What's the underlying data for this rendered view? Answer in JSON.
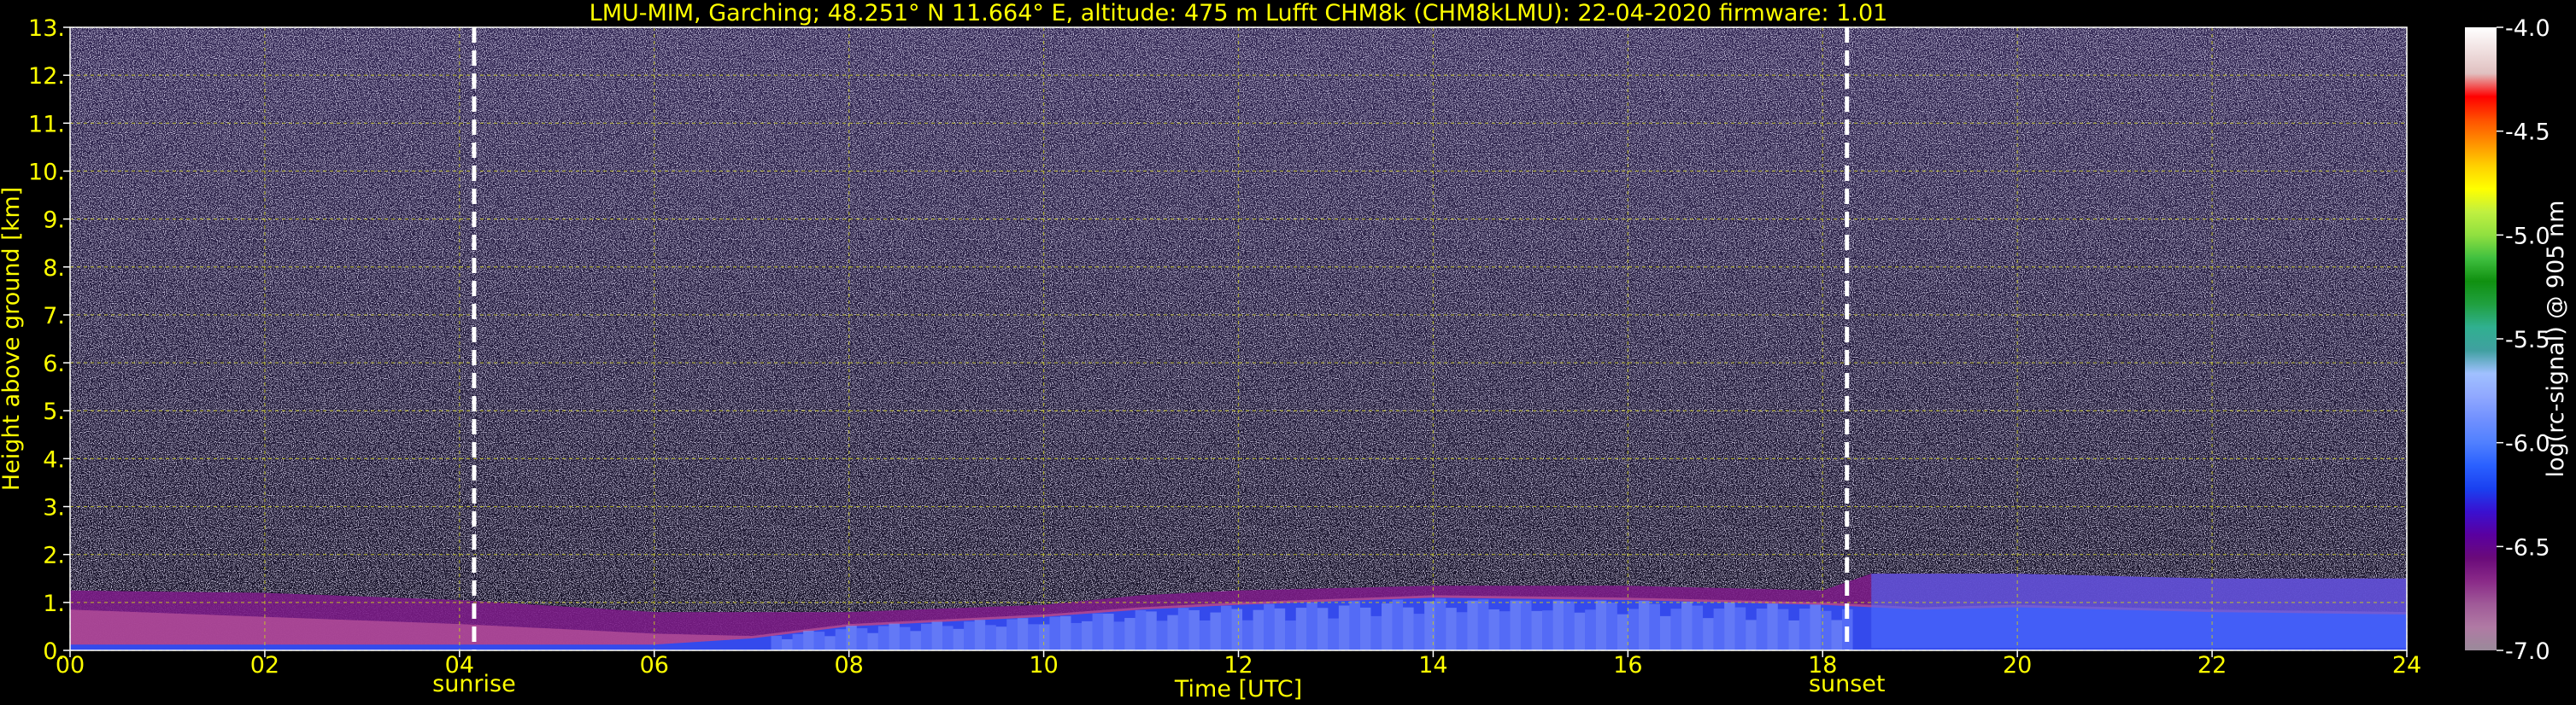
{
  "chart_data": {
    "type": "heatmap",
    "title": "LMU-MIM, Garching; 48.251° N 11.664° E, altitude: 475 m    Lufft CHM8k (CHM8kLMU): 22-04-2020    firmware: 1.01",
    "xlabel": "Time [UTC]",
    "ylabel": "Height above ground [km]",
    "xlim": [
      0,
      24
    ],
    "ylim": [
      0,
      13
    ],
    "x_ticks": [
      "00",
      "02",
      "04",
      "06",
      "08",
      "10",
      "12",
      "14",
      "16",
      "18",
      "20",
      "22",
      "24"
    ],
    "y_ticks": [
      "0.",
      "1.",
      "2.",
      "3.",
      "4.",
      "5.",
      "6.",
      "7.",
      "8.",
      "9.",
      "10.",
      "11.",
      "12.",
      "13."
    ],
    "grid": true,
    "events": [
      {
        "label": "sunrise",
        "time": 4.15
      },
      {
        "label": "sunset",
        "time": 18.25
      }
    ],
    "boundary_layer_top_km": [
      [
        0,
        1.25
      ],
      [
        2,
        1.2
      ],
      [
        4,
        1.05
      ],
      [
        6,
        0.8
      ],
      [
        8,
        0.8
      ],
      [
        10,
        0.95
      ],
      [
        11,
        1.15
      ],
      [
        12,
        1.25
      ],
      [
        14,
        1.35
      ],
      [
        16,
        1.35
      ],
      [
        18,
        1.25
      ],
      [
        18.5,
        1.6
      ],
      [
        20,
        1.6
      ],
      [
        22,
        1.5
      ],
      [
        24,
        1.5
      ]
    ],
    "aerosol_layer_top_km": [
      [
        0,
        0.85
      ],
      [
        4,
        0.55
      ],
      [
        6,
        0.35
      ],
      [
        7,
        0.3
      ],
      [
        8,
        0.55
      ],
      [
        10,
        0.75
      ],
      [
        11,
        0.9
      ],
      [
        12,
        1.0
      ],
      [
        14,
        1.15
      ],
      [
        16,
        1.1
      ],
      [
        18,
        1.0
      ],
      [
        19,
        0.9
      ],
      [
        20,
        0.95
      ],
      [
        22,
        0.85
      ],
      [
        24,
        0.8
      ]
    ],
    "colorbar": {
      "label": "log(rc-signal) @ 905 nm",
      "range": [
        -7.0,
        -4.0
      ],
      "ticks": [
        "-4.0",
        "-4.5",
        "-5.0",
        "-5.5",
        "-6.0",
        "-6.5",
        "-7.0"
      ],
      "colors": [
        "#9a8a9a",
        "#b07aa4",
        "#a05a98",
        "#8a2a88",
        "#6a0a7a",
        "#5a00a0",
        "#3a10d0",
        "#1a40f0",
        "#2a60ff",
        "#5080ff",
        "#7090ff",
        "#90a8ff",
        "#a0c0ff",
        "#40a0a0",
        "#30b090",
        "#20a040",
        "#109010",
        "#40c040",
        "#90e040",
        "#c0f040",
        "#ffff00",
        "#ffd000",
        "#ff9000",
        "#ff5000",
        "#ff0000",
        "#e0c0c0",
        "#f0e0e0",
        "#ffffff"
      ]
    }
  }
}
